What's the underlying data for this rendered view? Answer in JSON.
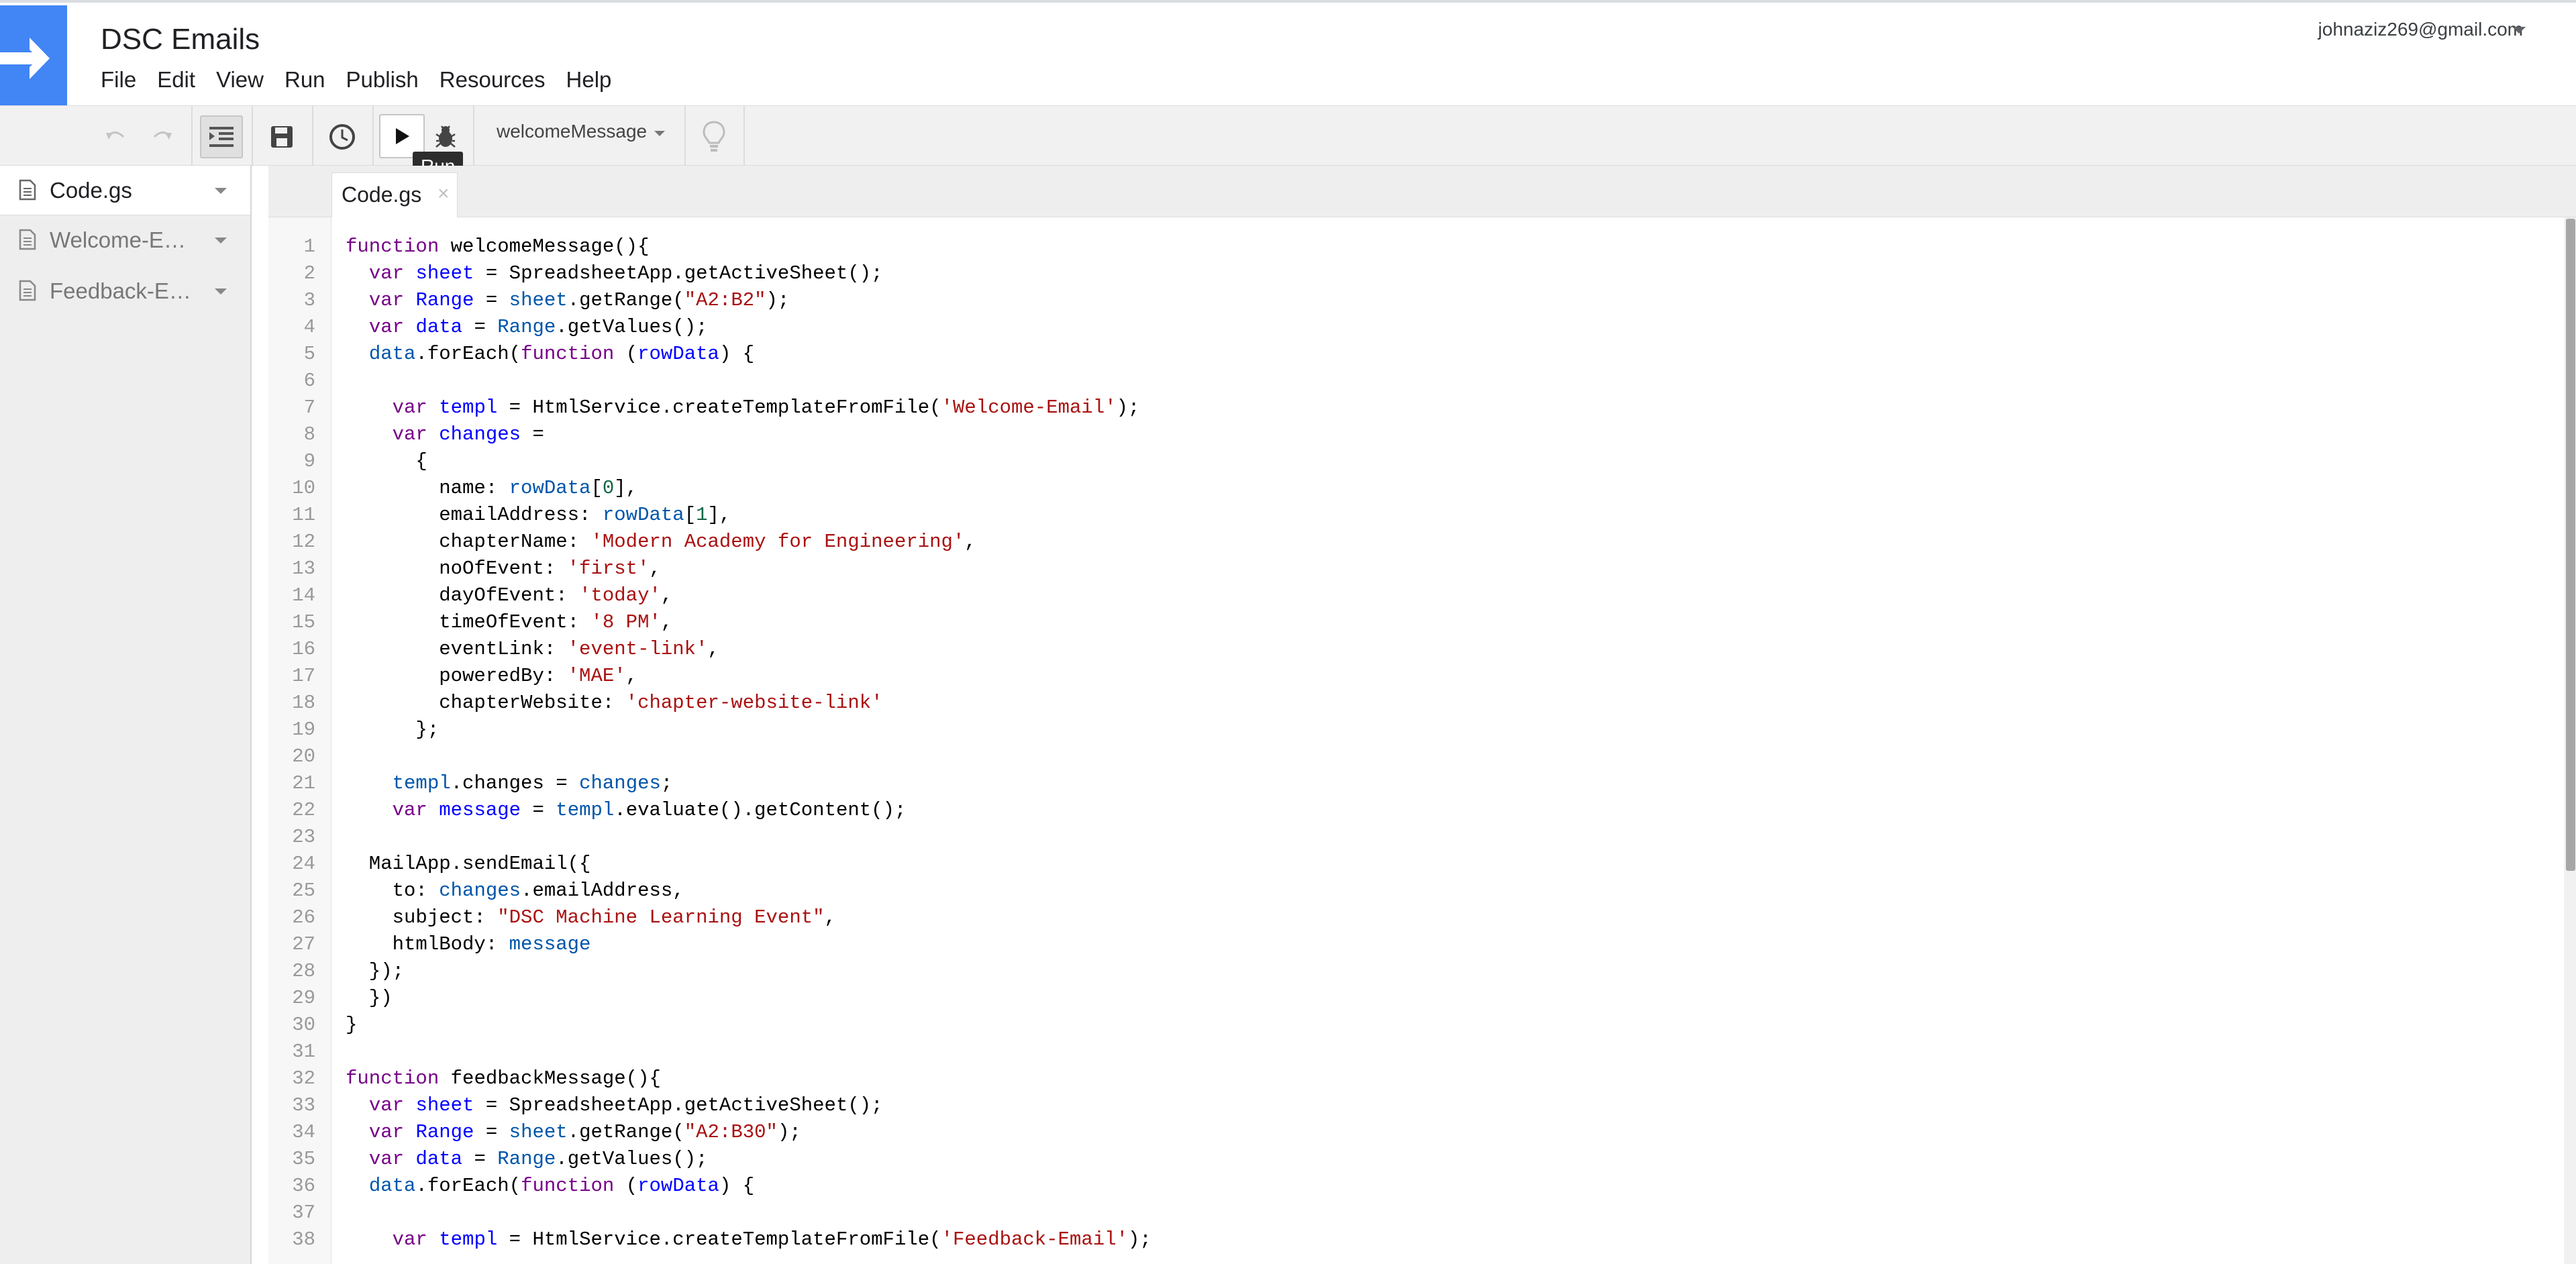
{
  "app": {
    "title": "DSC Emails",
    "account": "johnaziz269@gmail.com",
    "accent_color": "#4285f4"
  },
  "menu": [
    "File",
    "Edit",
    "View",
    "Run",
    "Publish",
    "Resources",
    "Help"
  ],
  "toolbar": {
    "undo_icon": "undo-icon",
    "redo_icon": "redo-icon",
    "indent_icon": "indent-icon",
    "save_icon": "save-icon",
    "triggers_icon": "clock-icon",
    "run_icon": "play-icon",
    "debug_icon": "bug-icon",
    "function_select": "welcomeMessage",
    "hint_icon": "lightbulb-icon",
    "tooltip": "Run"
  },
  "sidebar": {
    "files": [
      {
        "name": "Code.gs",
        "active": true
      },
      {
        "name": "Welcome-Em…",
        "active": false
      },
      {
        "name": "Feedback-E…",
        "active": false
      }
    ]
  },
  "editor": {
    "tab_label": "Code.gs",
    "tab_close": "×",
    "line_numbers": [
      "1",
      "2",
      "3",
      "4",
      "5",
      "6",
      "7",
      "8",
      "9",
      "10",
      "11",
      "12",
      "13",
      "14",
      "15",
      "16",
      "17",
      "18",
      "19",
      "20",
      "21",
      "22",
      "23",
      "24",
      "25",
      "26",
      "27",
      "28",
      "29",
      "30",
      "31",
      "32",
      "33",
      "34",
      "35",
      "36",
      "37",
      "38"
    ],
    "lines": [
      [
        [
          "kw",
          "function"
        ],
        [
          "p",
          " welcomeMessage(){"
        ]
      ],
      [
        [
          "p",
          "  "
        ],
        [
          "kw",
          "var"
        ],
        [
          "p",
          " "
        ],
        [
          "def",
          "sheet"
        ],
        [
          "p",
          " = SpreadsheetApp.getActiveSheet();"
        ]
      ],
      [
        [
          "p",
          "  "
        ],
        [
          "kw",
          "var"
        ],
        [
          "p",
          " "
        ],
        [
          "def",
          "Range"
        ],
        [
          "p",
          " = "
        ],
        [
          "var",
          "sheet"
        ],
        [
          "p",
          ".getRange("
        ],
        [
          "str",
          "\"A2:B2\""
        ],
        [
          "p",
          ");"
        ]
      ],
      [
        [
          "p",
          "  "
        ],
        [
          "kw",
          "var"
        ],
        [
          "p",
          " "
        ],
        [
          "def",
          "data"
        ],
        [
          "p",
          " = "
        ],
        [
          "var",
          "Range"
        ],
        [
          "p",
          ".getValues();"
        ]
      ],
      [
        [
          "p",
          "  "
        ],
        [
          "var",
          "data"
        ],
        [
          "p",
          ".forEach("
        ],
        [
          "kw",
          "function"
        ],
        [
          "p",
          " ("
        ],
        [
          "def",
          "rowData"
        ],
        [
          "p",
          ") {"
        ]
      ],
      [
        [
          "p",
          ""
        ]
      ],
      [
        [
          "p",
          "    "
        ],
        [
          "kw",
          "var"
        ],
        [
          "p",
          " "
        ],
        [
          "def",
          "templ"
        ],
        [
          "p",
          " = HtmlService.createTemplateFromFile("
        ],
        [
          "str",
          "'Welcome-Email'"
        ],
        [
          "p",
          ");"
        ]
      ],
      [
        [
          "p",
          "    "
        ],
        [
          "kw",
          "var"
        ],
        [
          "p",
          " "
        ],
        [
          "def",
          "changes"
        ],
        [
          "p",
          " ="
        ]
      ],
      [
        [
          "p",
          "      {"
        ]
      ],
      [
        [
          "p",
          "        name: "
        ],
        [
          "var",
          "rowData"
        ],
        [
          "p",
          "["
        ],
        [
          "num",
          "0"
        ],
        [
          "p",
          "],"
        ]
      ],
      [
        [
          "p",
          "        emailAddress: "
        ],
        [
          "var",
          "rowData"
        ],
        [
          "p",
          "["
        ],
        [
          "num",
          "1"
        ],
        [
          "p",
          "],"
        ]
      ],
      [
        [
          "p",
          "        chapterName: "
        ],
        [
          "str",
          "'Modern Academy for Engineering'"
        ],
        [
          "p",
          ","
        ]
      ],
      [
        [
          "p",
          "        noOfEvent: "
        ],
        [
          "str",
          "'first'"
        ],
        [
          "p",
          ","
        ]
      ],
      [
        [
          "p",
          "        dayOfEvent: "
        ],
        [
          "str",
          "'today'"
        ],
        [
          "p",
          ","
        ]
      ],
      [
        [
          "p",
          "        timeOfEvent: "
        ],
        [
          "str",
          "'8 PM'"
        ],
        [
          "p",
          ","
        ]
      ],
      [
        [
          "p",
          "        eventLink: "
        ],
        [
          "str",
          "'event-link'"
        ],
        [
          "p",
          ","
        ]
      ],
      [
        [
          "p",
          "        poweredBy: "
        ],
        [
          "str",
          "'MAE'"
        ],
        [
          "p",
          ","
        ]
      ],
      [
        [
          "p",
          "        chapterWebsite: "
        ],
        [
          "str",
          "'chapter-website-link'"
        ]
      ],
      [
        [
          "p",
          "      };"
        ]
      ],
      [
        [
          "p",
          ""
        ]
      ],
      [
        [
          "p",
          "    "
        ],
        [
          "var",
          "templ"
        ],
        [
          "p",
          ".changes = "
        ],
        [
          "var",
          "changes"
        ],
        [
          "p",
          ";"
        ]
      ],
      [
        [
          "p",
          "    "
        ],
        [
          "kw",
          "var"
        ],
        [
          "p",
          " "
        ],
        [
          "def",
          "message"
        ],
        [
          "p",
          " = "
        ],
        [
          "var",
          "templ"
        ],
        [
          "p",
          ".evaluate().getContent();"
        ]
      ],
      [
        [
          "p",
          ""
        ]
      ],
      [
        [
          "p",
          "  MailApp.sendEmail({"
        ]
      ],
      [
        [
          "p",
          "    to: "
        ],
        [
          "var",
          "changes"
        ],
        [
          "p",
          ".emailAddress,"
        ]
      ],
      [
        [
          "p",
          "    subject: "
        ],
        [
          "str",
          "\"DSC Machine Learning Event\""
        ],
        [
          "p",
          ","
        ]
      ],
      [
        [
          "p",
          "    htmlBody: "
        ],
        [
          "var",
          "message"
        ]
      ],
      [
        [
          "p",
          "  });"
        ]
      ],
      [
        [
          "p",
          "  })"
        ]
      ],
      [
        [
          "p",
          "}"
        ]
      ],
      [
        [
          "p",
          ""
        ]
      ],
      [
        [
          "kw",
          "function"
        ],
        [
          "p",
          " feedbackMessage(){"
        ]
      ],
      [
        [
          "p",
          "  "
        ],
        [
          "kw",
          "var"
        ],
        [
          "p",
          " "
        ],
        [
          "def",
          "sheet"
        ],
        [
          "p",
          " = SpreadsheetApp.getActiveSheet();"
        ]
      ],
      [
        [
          "p",
          "  "
        ],
        [
          "kw",
          "var"
        ],
        [
          "p",
          " "
        ],
        [
          "def",
          "Range"
        ],
        [
          "p",
          " = "
        ],
        [
          "var",
          "sheet"
        ],
        [
          "p",
          ".getRange("
        ],
        [
          "str",
          "\"A2:B30\""
        ],
        [
          "p",
          ");"
        ]
      ],
      [
        [
          "p",
          "  "
        ],
        [
          "kw",
          "var"
        ],
        [
          "p",
          " "
        ],
        [
          "def",
          "data"
        ],
        [
          "p",
          " = "
        ],
        [
          "var",
          "Range"
        ],
        [
          "p",
          ".getValues();"
        ]
      ],
      [
        [
          "p",
          "  "
        ],
        [
          "var",
          "data"
        ],
        [
          "p",
          ".forEach("
        ],
        [
          "kw",
          "function"
        ],
        [
          "p",
          " ("
        ],
        [
          "def",
          "rowData"
        ],
        [
          "p",
          ") {"
        ]
      ],
      [
        [
          "p",
          ""
        ]
      ],
      [
        [
          "p",
          "    "
        ],
        [
          "kw",
          "var"
        ],
        [
          "p",
          " "
        ],
        [
          "def",
          "templ"
        ],
        [
          "p",
          " = HtmlService.createTemplateFromFile("
        ],
        [
          "str",
          "'Feedback-Email'"
        ],
        [
          "p",
          ");"
        ]
      ]
    ]
  }
}
